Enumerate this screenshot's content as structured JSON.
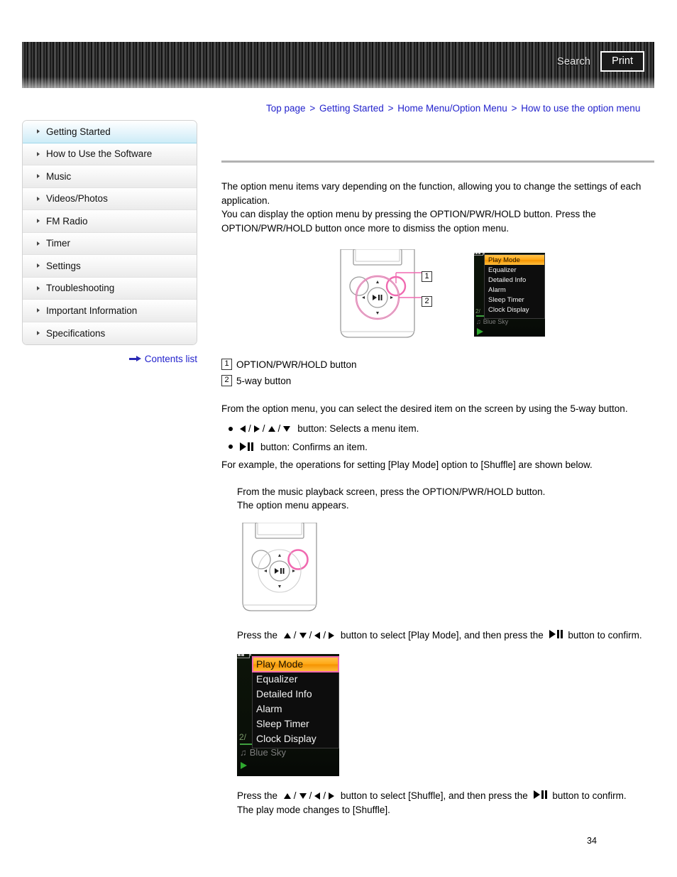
{
  "header": {
    "search_label": "Search",
    "print_label": "Print"
  },
  "breadcrumb": {
    "separator": ">",
    "items": [
      {
        "label": "Top page"
      },
      {
        "label": "Getting Started"
      },
      {
        "label": "Home Menu/Option Menu"
      },
      {
        "label": "How to use the option menu"
      }
    ]
  },
  "sidebar": {
    "items": [
      {
        "label": "Getting Started",
        "active": true
      },
      {
        "label": "How to Use the Software",
        "active": false
      },
      {
        "label": "Music",
        "active": false
      },
      {
        "label": "Videos/Photos",
        "active": false
      },
      {
        "label": "FM Radio",
        "active": false
      },
      {
        "label": "Timer",
        "active": false
      },
      {
        "label": "Settings",
        "active": false
      },
      {
        "label": "Troubleshooting",
        "active": false
      },
      {
        "label": "Important Information",
        "active": false
      },
      {
        "label": "Specifications",
        "active": false
      }
    ],
    "contents_link": "Contents list"
  },
  "main": {
    "intro_p1": "The option menu items vary depending on the function, allowing you to change the settings of each application.",
    "intro_p2": "You can display the option menu by pressing the OPTION/PWR/HOLD button. Press the OPTION/PWR/HOLD button once more to dismiss the option menu.",
    "callouts": [
      {
        "number": "1",
        "label": "OPTION/PWR/HOLD button"
      },
      {
        "number": "2",
        "label": "5-way button"
      }
    ],
    "five_way_intro": "From the option menu, you can select the desired item on the screen by using the 5-way button.",
    "bullet_select_suffix": "button: Selects a menu item.",
    "bullet_confirm_suffix": "button: Confirms an item.",
    "example_line": "For example, the operations for setting [Play Mode] option to [Shuffle] are shown below.",
    "step1_line1": "From the music playback screen, press the OPTION/PWR/HOLD button.",
    "step1_line2": "The option menu appears.",
    "step2_prefix": "Press the",
    "step2_mid": "button to select [Play Mode], and then press the",
    "step2_suffix": "button to confirm.",
    "step3_prefix": "Press the",
    "step3_mid": "button to select [Shuffle], and then press the",
    "step3_suffix": "button to confirm.",
    "step3_result": "The play mode changes to [Shuffle]."
  },
  "option_menu": {
    "items": [
      {
        "label": "Play Mode",
        "selected": true
      },
      {
        "label": "Equalizer",
        "selected": false
      },
      {
        "label": "Detailed Info",
        "selected": false
      },
      {
        "label": "Alarm",
        "selected": false
      },
      {
        "label": "Sleep Timer",
        "selected": false
      },
      {
        "label": "Clock Display",
        "selected": false
      }
    ],
    "now_playing_track": "Blue Sky",
    "track_counter": "2/",
    "music_note_icon": "music-note-icon"
  },
  "page": {
    "number": "34"
  },
  "colors": {
    "link_blue": "#2222cc",
    "sidebar_active": "#cdecf7",
    "highlight_orange": "#ffa815",
    "callout_pink": "#f06ab0",
    "rule_grey": "#b2b2b2"
  }
}
